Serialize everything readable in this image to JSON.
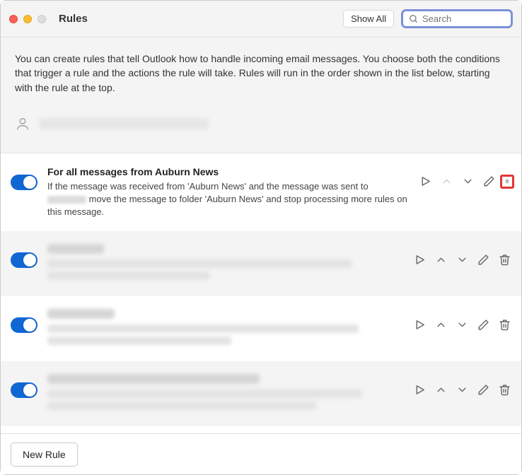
{
  "window": {
    "title": "Rules"
  },
  "header": {
    "showall_label": "Show All",
    "search_placeholder": "Search"
  },
  "description": "You can create rules that tell Outlook how to handle incoming email messages. You choose both the conditions that trigger a rule and the actions the rule will take. Rules will run in the order shown in the list below, starting with the rule at the top.",
  "rules": [
    {
      "title": "For all messages from Auburn News",
      "desc_prefix": "If the message was received from 'Auburn News' and the message was sent to ",
      "desc_suffix": " move the message to folder 'Auburn News' and stop processing more rules on this message.",
      "enabled": true,
      "alt": false,
      "up_disabled": true,
      "highlight_delete": true,
      "blurred": false
    },
    {
      "enabled": true,
      "alt": true,
      "blurred": true,
      "title_w": 80,
      "lines": [
        430,
        230
      ]
    },
    {
      "enabled": true,
      "alt": false,
      "blurred": true,
      "title_w": 95,
      "lines": [
        440,
        260
      ]
    },
    {
      "enabled": true,
      "alt": true,
      "blurred": true,
      "title_w": 300,
      "lines": [
        445,
        380
      ]
    },
    {
      "enabled": true,
      "alt": false,
      "blurred": true,
      "title_w": 85,
      "lines": []
    }
  ],
  "footer": {
    "new_rule_label": "New Rule"
  },
  "icons": {
    "run": "run-icon",
    "up": "chevron-up-icon",
    "down": "chevron-down-icon",
    "edit": "pencil-icon",
    "delete": "trash-icon",
    "search": "search-icon",
    "account": "person-icon"
  }
}
